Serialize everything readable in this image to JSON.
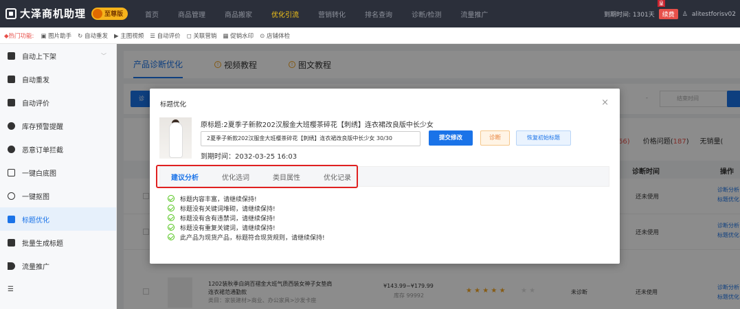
{
  "app": {
    "title": "大泽商机助理",
    "edition": "至尊版"
  },
  "nav": [
    "首页",
    "商品管理",
    "商品搬家",
    "优化引流",
    "营销转化",
    "排名查询",
    "诊断/检测",
    "流量推广"
  ],
  "nav_active_index": 3,
  "topright": {
    "expire": "到期时间: 1301天",
    "renew": "续费",
    "user": "alitestforisv02",
    "vip": "皇"
  },
  "toolbar": {
    "hot": "◆热门功能:",
    "items": [
      "图片助手",
      "自动重发",
      "主图视频",
      "自动评价",
      "关联营销",
      "促销水印",
      "店铺体检"
    ]
  },
  "sidebar": [
    {
      "label": "自动上下架",
      "caret": "﹀"
    },
    {
      "label": "自动重发"
    },
    {
      "label": "自动评价"
    },
    {
      "label": "库存预警提醒"
    },
    {
      "label": "恶意订单拦截"
    },
    {
      "label": "一键白底图"
    },
    {
      "label": "一键抠图"
    },
    {
      "label": "标题优化",
      "active": true
    },
    {
      "label": "批量生成标题"
    },
    {
      "label": "流量推广"
    },
    {
      "label": "☰"
    }
  ],
  "main_tabs": [
    {
      "label": "产品诊断优化",
      "active": true
    },
    {
      "label": "视频教程",
      "icon": "!"
    },
    {
      "label": "图文教程",
      "icon": "!"
    }
  ],
  "filter": {
    "btn": "诊",
    "end_placeholder": "结束时间",
    "dash": "-"
  },
  "stats": {
    "a": "66)",
    "price_label": "价格问题(",
    "price_count": "187",
    "price_close": ")",
    "none": "无销量("
  },
  "table": {
    "headers": {
      "time": "诊断时间",
      "op": "操作"
    },
    "rows": [
      {
        "use": "还未使用",
        "op1": "诊断分析",
        "op2": "标题优化"
      },
      {
        "use": "还未使用",
        "op1": "诊断分析",
        "op2": "标题优化"
      }
    ]
  },
  "product": {
    "title_l1": "1202装秋季白鸽百褶金大班气质西装女神子女垫肩",
    "title_l2": "连衣裙范通勤款",
    "cat": "类目：家装建材>商业、办公家具>沙发卡座",
    "price": "¥143.99~¥179.99",
    "stock": "库存 99992",
    "stars": "★ ★ ★ ★ ★",
    "stars_gray": "★ ★",
    "status": "未诊断",
    "use": "还未使用",
    "op1": "诊断分析",
    "op2": "标题优化"
  },
  "modal": {
    "title": "标题优化",
    "close": "×",
    "orig_title": "原标题:2夏季子新款202汉服金大班樱茶碎花【刺绣】连衣裙改良版中长少女",
    "input_value": "2夏季子新款202汉服金大班樱茶碎花【刺绣】连衣裙改良版中长少女 30/30",
    "submit": "提交修改",
    "diagnose": "诊断",
    "restore": "恢复初始标题",
    "expire": "到期时间：2032-03-25 16:03",
    "tabs": [
      "建议分析",
      "优化选词",
      "类目属性",
      "优化记录"
    ],
    "checks": [
      "标题内容丰富，请继续保持!",
      "标题没有关键词堆砌，请继续保持!",
      "标题没有含有违禁词，请继续保持!",
      "标题没有重复关键词，请继续保持!",
      "此产品为现货产品，标题符合现货规则，请继续保持!"
    ]
  }
}
